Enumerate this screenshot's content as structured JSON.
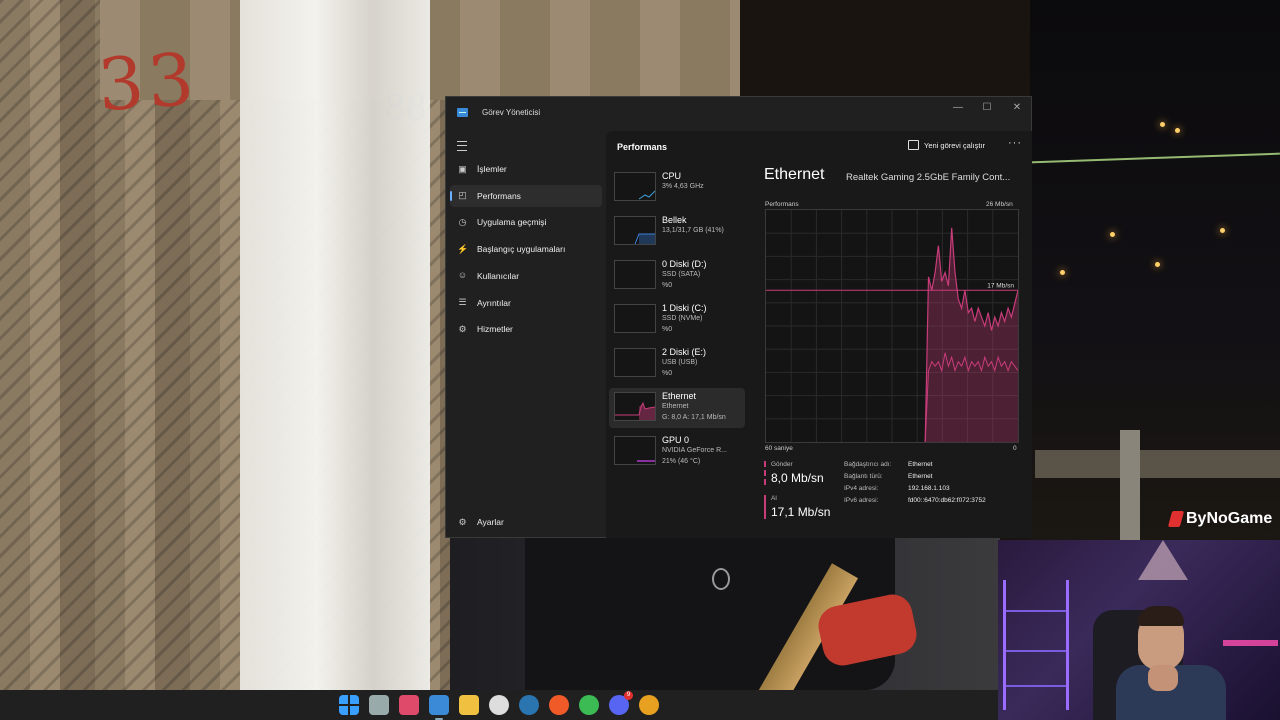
{
  "window": {
    "title": "Görev Yöneticisi",
    "minimize": "—",
    "maximize": "☐",
    "close": "✕"
  },
  "nav": {
    "items": [
      {
        "label": "İşlemler",
        "icon": "processes-icon",
        "glyph": "▣"
      },
      {
        "label": "Performans",
        "icon": "performance-icon",
        "glyph": "◰",
        "active": true
      },
      {
        "label": "Uygulama geçmişi",
        "icon": "app-history-icon",
        "glyph": "◷"
      },
      {
        "label": "Başlangıç uygulamaları",
        "icon": "startup-apps-icon",
        "glyph": "⚡"
      },
      {
        "label": "Kullanıcılar",
        "icon": "users-icon",
        "glyph": "☺"
      },
      {
        "label": "Ayrıntılar",
        "icon": "details-icon",
        "glyph": "☰"
      },
      {
        "label": "Hizmetler",
        "icon": "services-icon",
        "glyph": "⚙"
      }
    ],
    "settings": {
      "label": "Ayarlar",
      "icon": "settings-icon",
      "glyph": "⚙"
    }
  },
  "header": {
    "title": "Performans",
    "run_task": "Yeni görevi çalıştır",
    "more": "···"
  },
  "devices": [
    {
      "name": "CPU",
      "lines": [
        "3% 4,63 GHz"
      ],
      "color": "#3aa0d8"
    },
    {
      "name": "Bellek",
      "lines": [
        "13,1/31,7 GB (41%)"
      ],
      "color": "#3a7fd8"
    },
    {
      "name": "0 Diski (D:)",
      "lines": [
        "SSD (SATA)",
        "%0"
      ],
      "color": "#4aa83a"
    },
    {
      "name": "1 Diski (C:)",
      "lines": [
        "SSD (NVMe)",
        "%0"
      ],
      "color": "#4aa83a"
    },
    {
      "name": "2 Diski (E:)",
      "lines": [
        "USB (USB)",
        "%0"
      ],
      "color": "#4aa83a"
    },
    {
      "name": "Ethernet",
      "lines": [
        "Ethernet",
        "G: 8,0 A: 17,1 Mb/sn"
      ],
      "color": "#c83c7a",
      "selected": true
    },
    {
      "name": "GPU 0",
      "lines": [
        "NVIDIA GeForce R...",
        "21% (46 °C)"
      ],
      "color": "#b03ad0"
    }
  ],
  "detail": {
    "title": "Ethernet",
    "adapter": "Realtek Gaming 2.5GbE Family Cont...",
    "graph_label": "Performans",
    "graph_max": "26 Mb/sn",
    "graph_marker": "17 Mb/sn",
    "time_label": "60 saniye",
    "time_end": "0",
    "send_label": "Gönder",
    "send_value": "8,0 Mb/sn",
    "recv_label": "Al",
    "recv_value": "17,1 Mb/sn",
    "props": [
      {
        "k": "Bağdaştırıcı adı:",
        "v": "Ethernet"
      },
      {
        "k": "Bağlantı türü:",
        "v": "Ethernet"
      },
      {
        "k": "IPv4 adresi:",
        "v": "192.168.1.103"
      },
      {
        "k": "IPv6 adresi:",
        "v": "fd00::6470:db62:f072:3752"
      }
    ]
  },
  "chart_data": {
    "type": "area",
    "unit": "Mb/sn",
    "ylim": [
      0,
      26
    ],
    "xlim": [
      60,
      0
    ],
    "series": [
      {
        "name": "Al",
        "values": [
          0,
          0,
          0,
          0,
          0,
          0,
          0,
          0,
          0,
          0,
          0,
          0,
          0,
          0,
          0,
          0,
          0,
          0,
          0,
          0,
          0,
          0,
          0,
          0,
          0,
          0,
          0,
          0,
          0,
          0,
          0,
          0,
          0,
          0,
          0,
          0,
          0,
          0,
          0,
          0,
          0,
          0,
          0,
          0,
          0,
          0,
          0,
          0,
          0,
          18.5,
          17,
          19,
          22,
          18,
          19,
          17.5,
          24,
          19,
          16,
          15,
          17,
          14.5,
          15,
          13.5,
          15,
          14,
          13,
          14.5,
          12.5,
          14,
          13,
          14.5,
          13.5,
          15,
          14,
          15.5,
          17
        ]
      },
      {
        "name": "Gönder",
        "values": [
          0,
          0,
          0,
          0,
          0,
          0,
          0,
          0,
          0,
          0,
          0,
          0,
          0,
          0,
          0,
          0,
          0,
          0,
          0,
          0,
          0,
          0,
          0,
          0,
          0,
          0,
          0,
          0,
          0,
          0,
          0,
          0,
          0,
          0,
          0,
          0,
          0,
          0,
          0,
          0,
          0,
          0,
          0,
          0,
          0,
          0,
          0,
          0,
          0,
          8,
          9,
          8.5,
          9,
          8,
          10,
          8.5,
          9.5,
          8,
          9,
          8.5,
          9.5,
          8,
          9,
          8.5,
          9,
          8,
          9.5,
          8.5,
          9,
          8,
          9.5,
          8.5,
          9,
          8,
          9,
          8.5,
          8
        ]
      }
    ],
    "marker_value": 17,
    "color": "#c83c7a"
  },
  "taskbar": {
    "icons": [
      {
        "name": "windows-start-icon",
        "cls": "win",
        "color": "#3aa0ff"
      },
      {
        "name": "task-view-icon",
        "color": "#9aa"
      },
      {
        "name": "snipping-tool-icon",
        "color": "#e04a6a"
      },
      {
        "name": "task-manager-icon",
        "color": "#3a8ad8",
        "active": true
      },
      {
        "name": "file-explorer-icon",
        "color": "#f0c040"
      },
      {
        "name": "obs-icon",
        "color": "#ddd"
      },
      {
        "name": "steam-icon",
        "color": "#2a75b0"
      },
      {
        "name": "brave-icon",
        "color": "#f05a28"
      },
      {
        "name": "chrome-icon",
        "color": "#3cba54"
      },
      {
        "name": "discord-icon",
        "color": "#5865f2",
        "badge": "9"
      },
      {
        "name": "chrome-profile-icon",
        "color": "#e8a020"
      }
    ]
  },
  "overlay": {
    "brand": "ByNoGame"
  },
  "scene": {
    "painted_number": "33",
    "painted_blue": "88"
  }
}
